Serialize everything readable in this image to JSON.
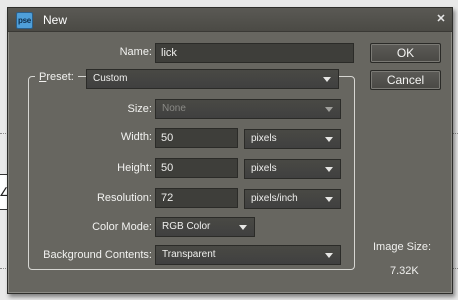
{
  "dialog": {
    "title": "New",
    "app_icon_text": "pse"
  },
  "form": {
    "name_label": "Name:",
    "name_value": "lick",
    "preset_label_u": "P",
    "preset_label_rest": "reset:",
    "preset_value": "Custom",
    "size_label": "Size:",
    "size_value": "None",
    "width_label": "Width:",
    "width_value": "50",
    "width_unit": "pixels",
    "height_label": "Height:",
    "height_value": "50",
    "height_unit": "pixels",
    "resolution_label": "Resolution:",
    "resolution_value": "72",
    "resolution_unit": "pixels/inch",
    "color_mode_label": "Color Mode:",
    "color_mode_value": "RGB Color",
    "bg_contents_label": "Background Contents:",
    "bg_contents_value": "Transparent"
  },
  "buttons": {
    "ok": "OK",
    "cancel": "Cancel"
  },
  "info": {
    "image_size_label": "Image Size:",
    "image_size_value": "7.32K"
  },
  "background": {
    "left_box_glyph": "∠"
  }
}
